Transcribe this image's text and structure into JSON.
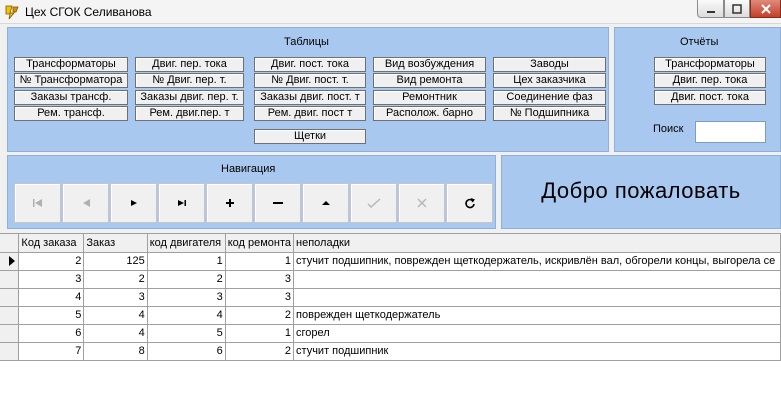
{
  "window": {
    "title": "Цех СГОК Селиванова",
    "icon": "app-logo-icon",
    "controls": [
      "minimize-icon",
      "maximize-icon",
      "close-icon"
    ]
  },
  "tables_panel": {
    "title": "Таблицы",
    "buttons": [
      "Трансформаторы",
      "Двиг. пер. тока",
      "Двиг. пост. тока",
      "Вид возбуждения",
      "Заводы",
      "№ Трансформатора",
      "№ Двиг. пер. т.",
      "№ Двиг. пост. т.",
      "Вид ремонта",
      "Цех заказчика",
      "Заказы трансф.",
      "Заказы двиг. пер. т.",
      "Заказы двиг. пост. т",
      "Ремонтник",
      "Соединение фаз",
      "Рем. трансф.",
      "Рем. двиг.пер. т",
      "Рем. двиг. пост т",
      "Располож. барно",
      "№ Подшипника",
      "Щетки"
    ]
  },
  "reports_panel": {
    "title": "Отчёты",
    "buttons": [
      "Трансформаторы",
      "Двиг. пер. тока",
      "Двиг. пост. тока"
    ],
    "search_label": "Поиск",
    "search_value": ""
  },
  "navigation": {
    "title": "Навигация",
    "buttons": [
      "first-record-icon",
      "prior-record-icon",
      "next-record-icon",
      "last-record-icon",
      "insert-record-icon",
      "delete-record-icon",
      "edit-record-icon",
      "post-edit-icon",
      "cancel-edit-icon",
      "refresh-data-icon"
    ]
  },
  "welcome_text": "Добро пожаловать",
  "grid": {
    "columns": [
      "Код заказа",
      "Заказ",
      "код двигателя",
      "код ремонта",
      "неполадки"
    ],
    "rows": [
      {
        "code": "2",
        "order": "125",
        "motor": "1",
        "repair": "1",
        "issue": "стучит подшипник, поврежден щеткодержатель, искривлён вал, обгорели концы, выгорела се"
      },
      {
        "code": "3",
        "order": "2",
        "motor": "2",
        "repair": "3",
        "issue": ""
      },
      {
        "code": "4",
        "order": "3",
        "motor": "3",
        "repair": "3",
        "issue": ""
      },
      {
        "code": "5",
        "order": "4",
        "motor": "4",
        "repair": "2",
        "issue": "поврежден щеткодержатель"
      },
      {
        "code": "6",
        "order": "4",
        "motor": "5",
        "repair": "1",
        "issue": "сгорел"
      },
      {
        "code": "7",
        "order": "8",
        "motor": "6",
        "repair": "2",
        "issue": "стучит подшипник"
      }
    ],
    "current_row": 1
  }
}
